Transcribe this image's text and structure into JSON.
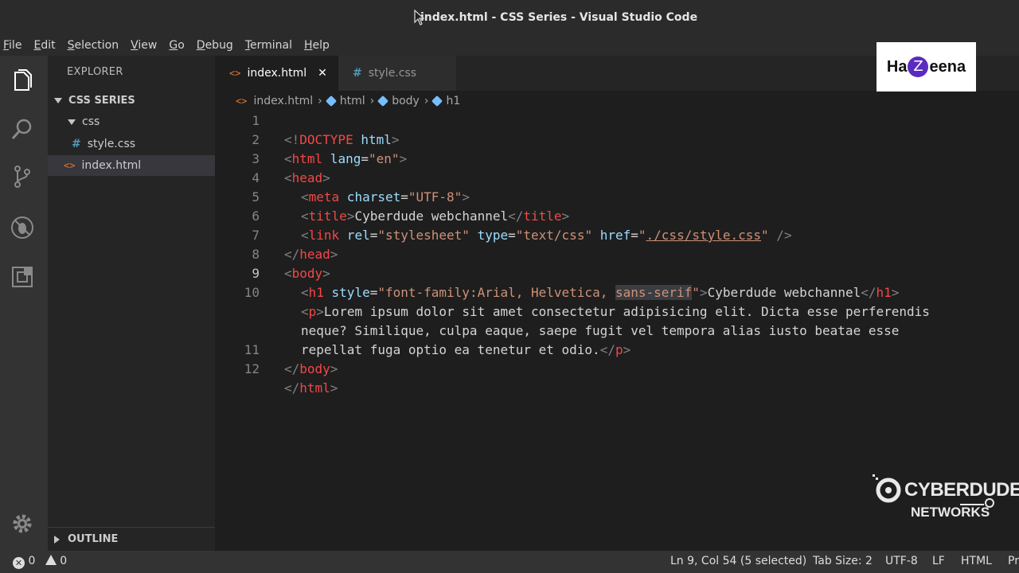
{
  "window": {
    "title": "index.html - CSS Series - Visual Studio Code"
  },
  "menu": {
    "items": [
      {
        "label": "File",
        "key": "F",
        "rest": "ile"
      },
      {
        "label": "Edit",
        "key": "E",
        "rest": "dit"
      },
      {
        "label": "Selection",
        "key": "S",
        "rest": "election"
      },
      {
        "label": "View",
        "key": "V",
        "rest": "iew"
      },
      {
        "label": "Go",
        "key": "G",
        "rest": "o"
      },
      {
        "label": "Debug",
        "key": "D",
        "rest": "ebug"
      },
      {
        "label": "Terminal",
        "key": "T",
        "rest": "erminal"
      },
      {
        "label": "Help",
        "key": "H",
        "rest": "elp"
      }
    ]
  },
  "activity_bar": {
    "icons": [
      "files-icon",
      "search-icon",
      "source-control-icon",
      "debug-icon",
      "extensions-icon",
      "gear-icon"
    ]
  },
  "sidebar": {
    "header": "EXPLORER",
    "section": "CSS SERIES",
    "folder": "css",
    "files": [
      "style.css",
      "index.html"
    ],
    "outline": "OUTLINE"
  },
  "tabs": [
    {
      "label": "index.html",
      "active": true
    },
    {
      "label": "style.css",
      "active": false
    }
  ],
  "breadcrumb": [
    "index.html",
    "html",
    "body",
    "h1"
  ],
  "editor": {
    "line_numbers": [
      "1",
      "2",
      "3",
      "4",
      "5",
      "6",
      "7",
      "8",
      "9",
      "10",
      "11",
      "12"
    ],
    "lines": {
      "l1": {
        "a": "<!",
        "b": "DOCTYPE",
        "c": " html",
        "d": ">"
      },
      "l2": {
        "a": "<",
        "b": "html",
        "c": " lang",
        "d": "=",
        "e": "\"en\"",
        "f": ">"
      },
      "l3": {
        "a": "<",
        "b": "head",
        "c": ">"
      },
      "l4": {
        "a": "<",
        "b": "meta",
        "c": " charset",
        "d": "=",
        "e": "\"UTF-8\"",
        "f": ">"
      },
      "l5": {
        "a": "<",
        "b": "title",
        "c": ">",
        "d": "Cyberdude webchannel",
        "e": "</",
        "f": "title",
        "g": ">"
      },
      "l6": {
        "a": "<",
        "b": "link",
        "c": " rel",
        "d": "=",
        "e": "\"stylesheet\"",
        "f": " type",
        "g": "=",
        "h": "\"text/css\"",
        "i": " href",
        "j": "=",
        "k": "\"",
        "l": "./css/style.css",
        "m": "\"",
        "n": " />"
      },
      "l7": {
        "a": "</",
        "b": "head",
        "c": ">"
      },
      "l8": {
        "a": "<",
        "b": "body",
        "c": ">"
      },
      "l9": {
        "a": "<",
        "b": "h1",
        "c": " style",
        "d": "=",
        "e": "\"font-family:Arial, Helvetica, ",
        "f": "sans-serif",
        "g": "\"",
        "h": ">",
        "i": "Cyberdude webchannel",
        "j": "</",
        "k": "h1",
        "l": ">"
      },
      "l10a": {
        "a": "<",
        "b": "p",
        "c": ">",
        "d": "Lorem ipsum dolor sit amet consectetur adipisicing elit. Dicta esse perferendis"
      },
      "l10b": {
        "d": "neque? Similique, culpa eaque, saepe fugit vel tempora alias iusto beatae esse"
      },
      "l10c": {
        "d": "repellat fuga optio ea tenetur et odio.",
        "e": "</",
        "f": "p",
        "g": ">"
      },
      "l11": {
        "a": "</",
        "b": "body",
        "c": ">"
      },
      "l12": {
        "a": "</",
        "b": "html",
        "c": ">"
      }
    }
  },
  "logos": {
    "top": {
      "left": "Ha",
      "mid": "Z",
      "right": "eena"
    },
    "bottom": {
      "line1": "CYBERDUDE",
      "line2": "NETWORKS"
    }
  },
  "status": {
    "errors": "0",
    "warnings": "0",
    "position": "Ln 9, Col 54 (5 selected)",
    "tab_size": "Tab Size: 2",
    "encoding": "UTF-8",
    "eol": "LF",
    "language": "HTML",
    "cut": "Pr"
  }
}
